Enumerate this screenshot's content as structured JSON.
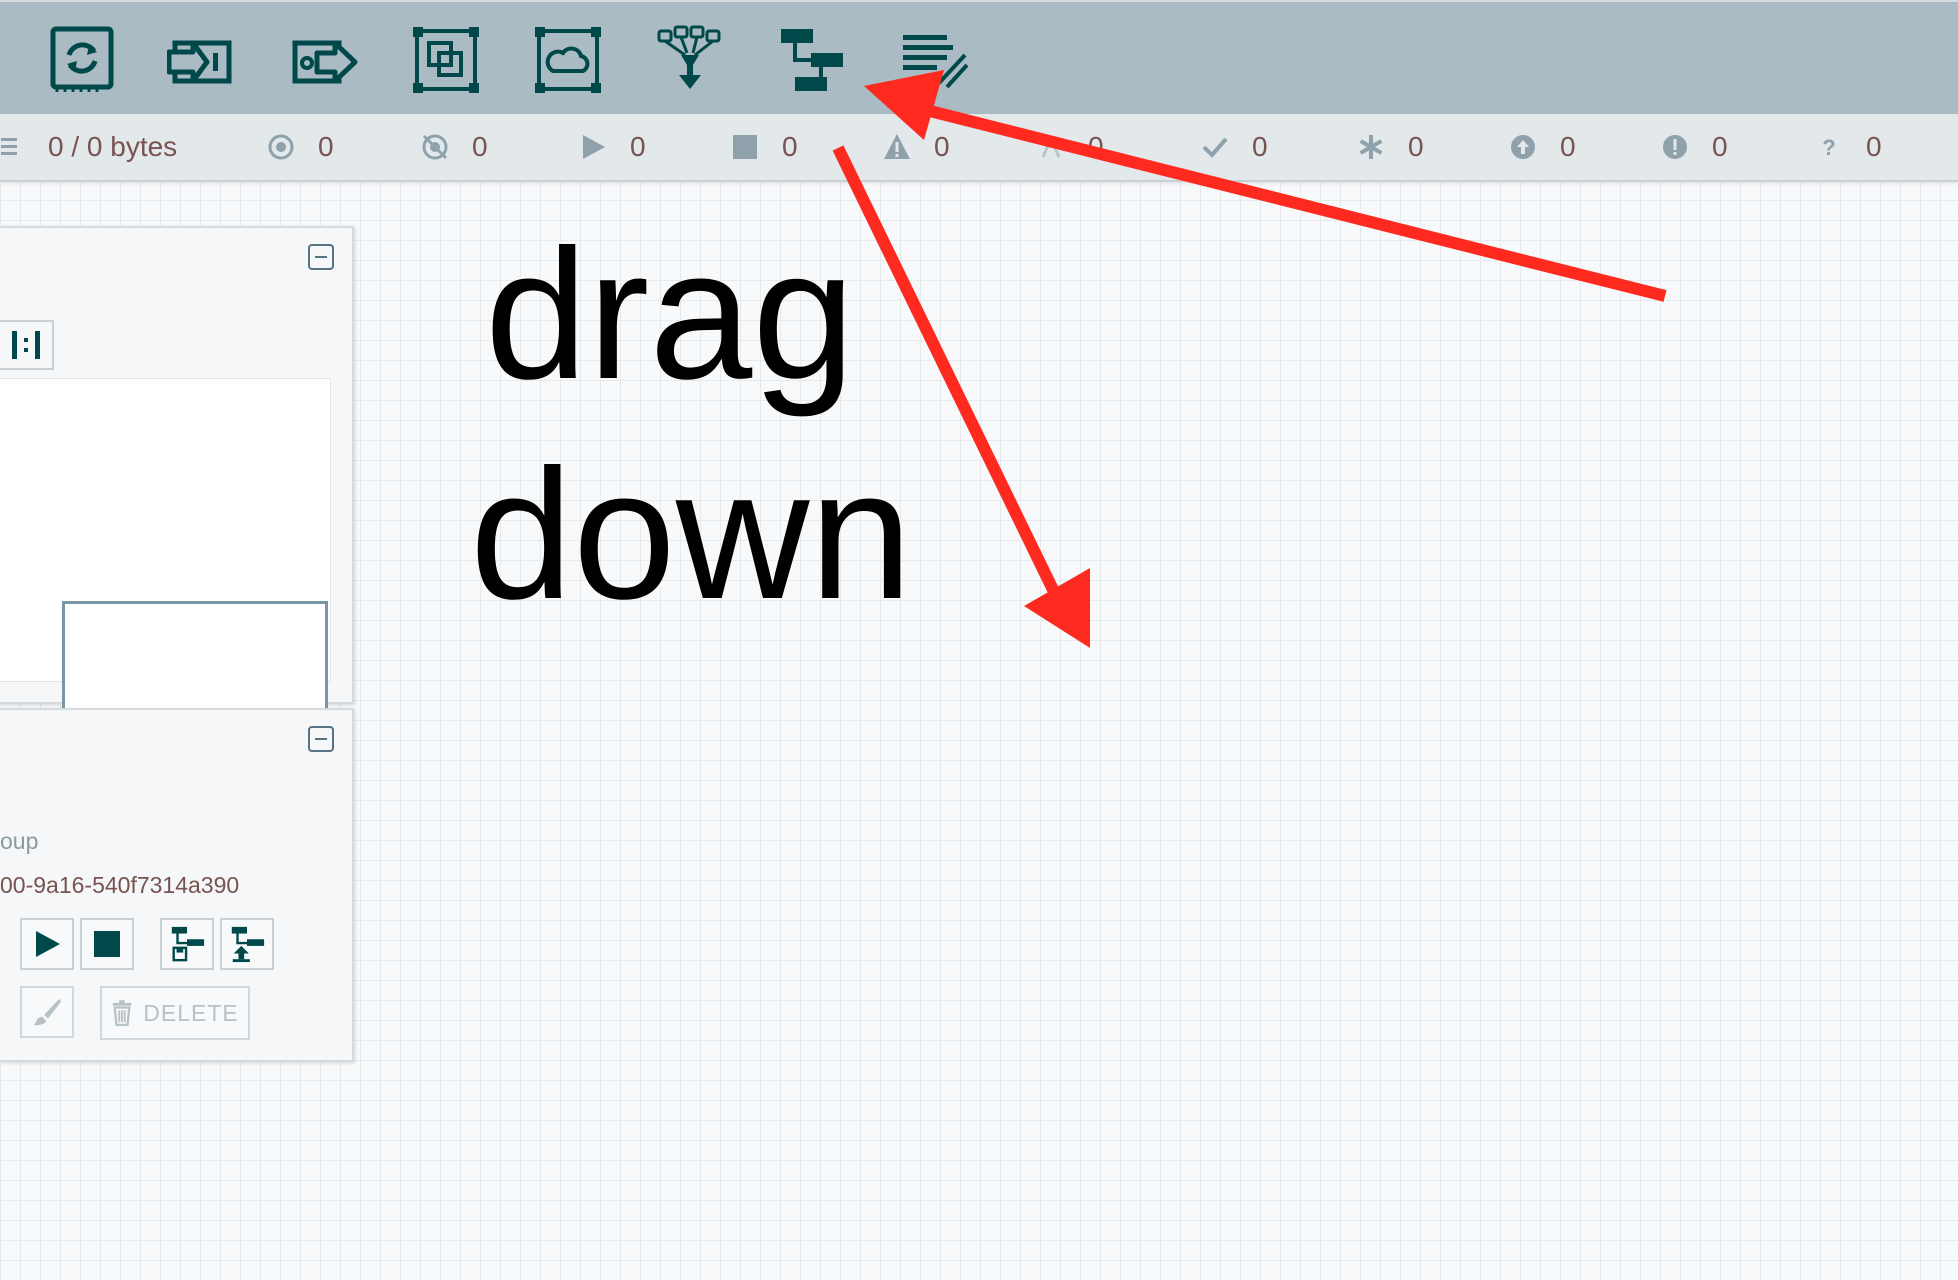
{
  "toolbar": {
    "items": [
      {
        "icon": "processor-icon"
      },
      {
        "icon": "input-port-icon"
      },
      {
        "icon": "output-port-icon"
      },
      {
        "icon": "process-group-icon"
      },
      {
        "icon": "remote-process-group-icon"
      },
      {
        "icon": "funnel-icon"
      },
      {
        "icon": "template-icon"
      },
      {
        "icon": "label-icon"
      }
    ],
    "icon_color": "#004849",
    "background": "#aabbc3"
  },
  "status": {
    "queued": "0 / 0 bytes",
    "transmitting": "0",
    "not_transmitting": "0",
    "running": "0",
    "stopped": "0",
    "invalid": "0",
    "disabled": "0",
    "up_to_date": "0",
    "locally_modified": "0",
    "stale": "0",
    "locally_modified_and_stale": "0",
    "sync_failure": "0"
  },
  "operate": {
    "label_partial": "oup",
    "id_partial": "00-9a16-540f7314a390",
    "delete_label": "DELETE"
  },
  "annotation": {
    "line1": "drag",
    "line2": "down",
    "arrow_color": "#ff2a1f"
  }
}
